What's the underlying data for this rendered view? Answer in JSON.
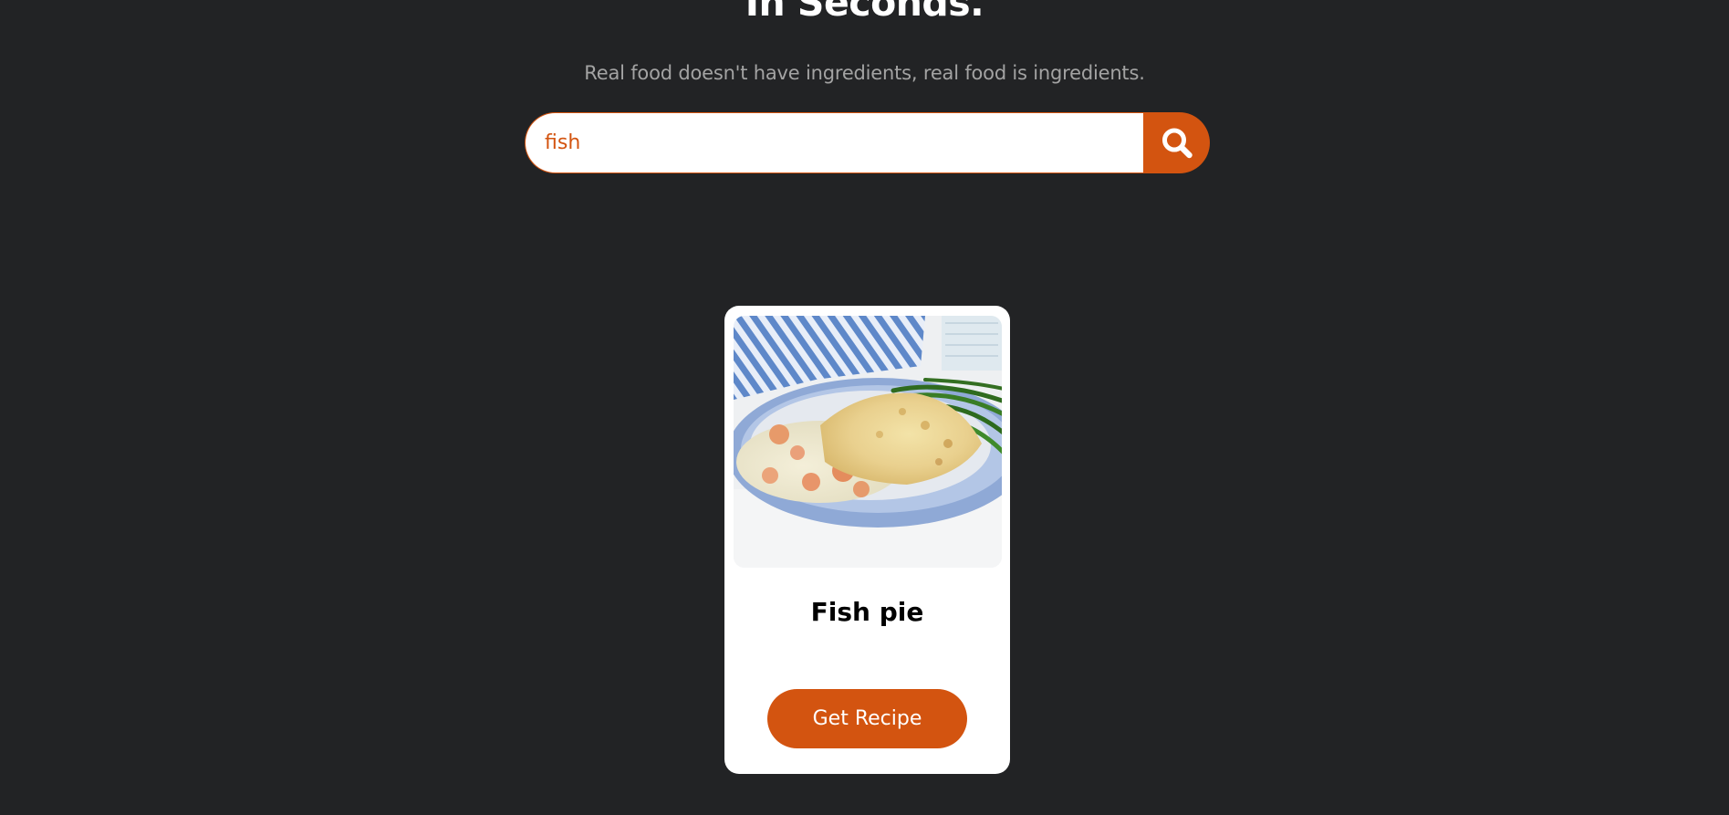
{
  "hero": {
    "title": "In Seconds.",
    "subtitle": "Real food doesn't have ingredients, real food is ingredients."
  },
  "search": {
    "value": "fish",
    "button_icon": "search-icon"
  },
  "results": [
    {
      "title": "Fish pie",
      "image": "fish-pie-photo",
      "button_label": "Get Recipe"
    }
  ],
  "colors": {
    "background": "#222325",
    "accent": "#d35410",
    "card": "#ffffff",
    "subtitle": "#a3a3a3"
  }
}
